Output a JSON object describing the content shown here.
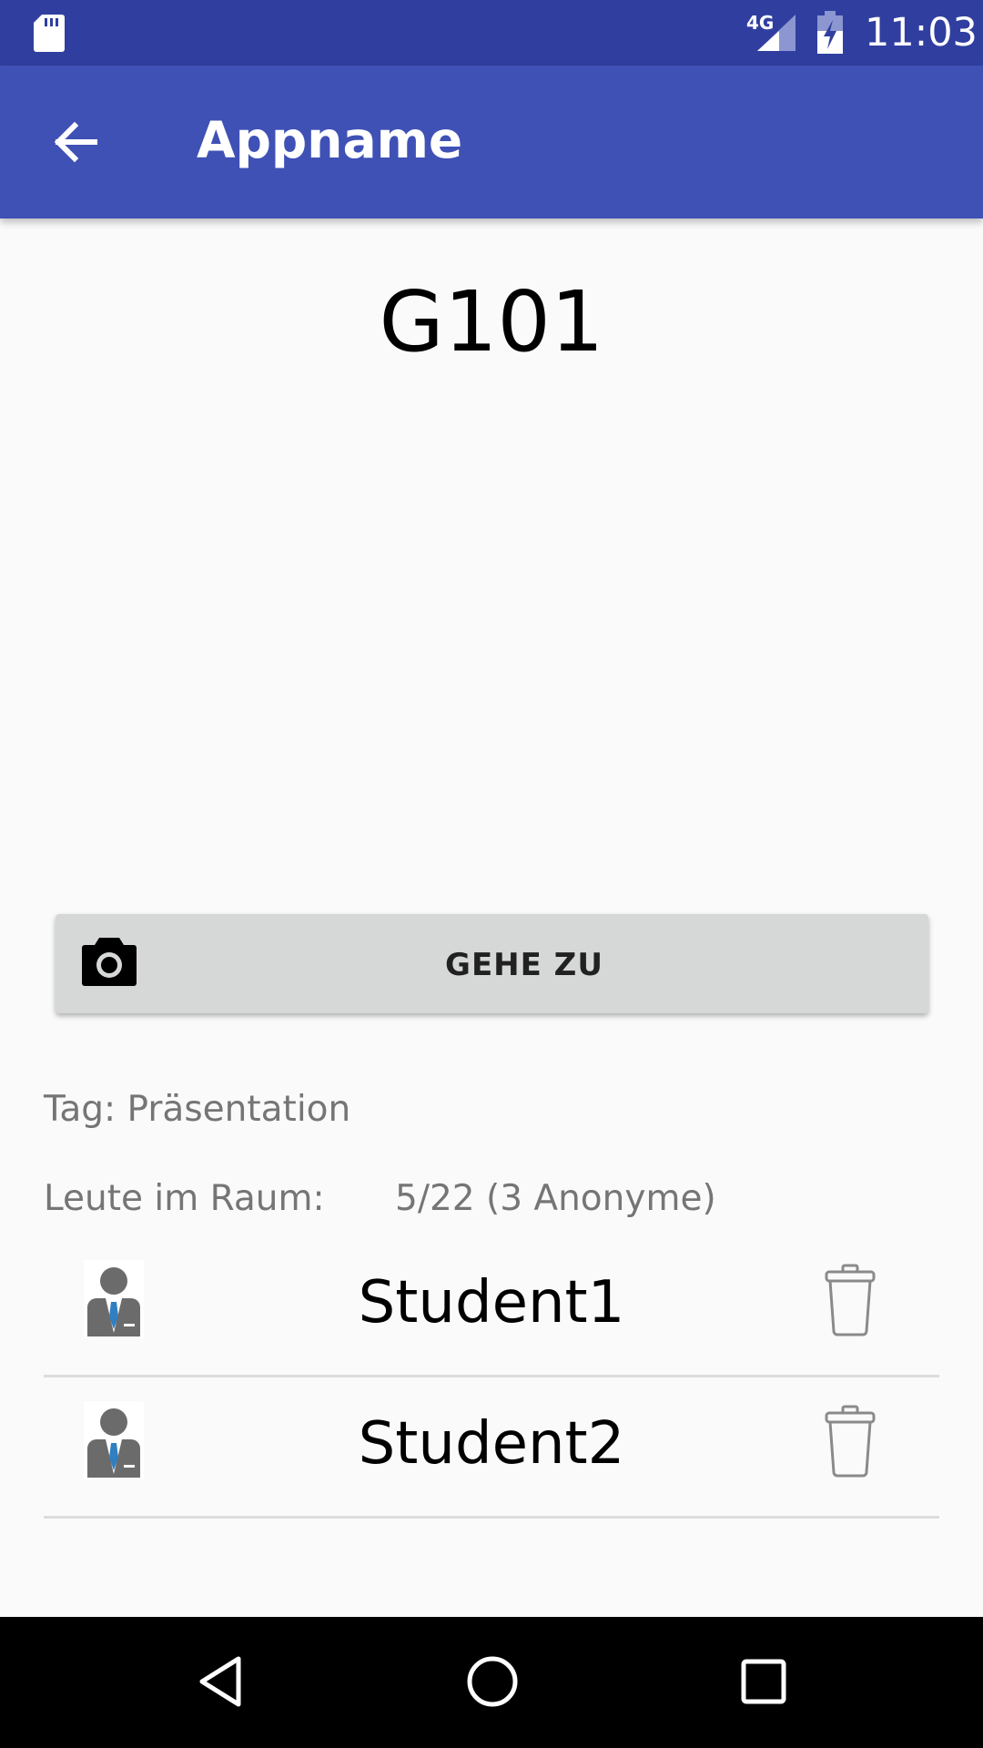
{
  "status_bar": {
    "network": "4G",
    "time": "11:03"
  },
  "app_bar": {
    "title": "Appname"
  },
  "room": {
    "name": "G101"
  },
  "goto_button": {
    "label": "GEHE ZU"
  },
  "info": {
    "tag": "Tag: Präsentation",
    "people_label": "Leute im Raum:",
    "people_count": "5/22 (3 Anonyme)"
  },
  "students": [
    {
      "name": "Student1"
    },
    {
      "name": "Student2"
    }
  ],
  "colors": {
    "status_bar": "#303f9f",
    "app_bar": "#3f51b5",
    "button": "#d6d7d7",
    "background": "#fafafa"
  }
}
